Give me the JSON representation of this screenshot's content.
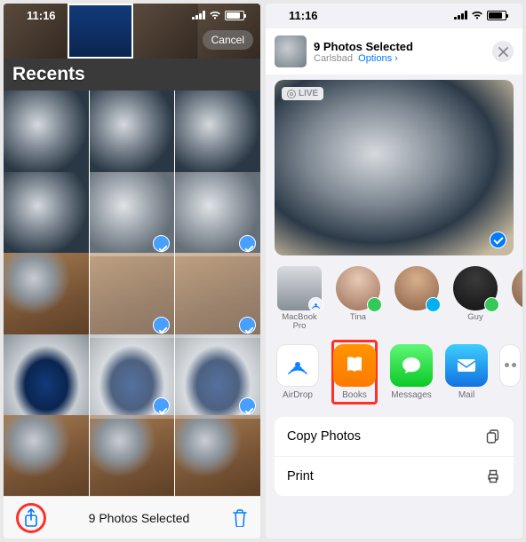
{
  "left": {
    "time": "11:16",
    "cancel": "Cancel",
    "album": "Recents",
    "selected_count": "9 Photos Selected"
  },
  "right": {
    "time": "11:16",
    "header_title": "9 Photos Selected",
    "header_location": "Carlsbad",
    "header_options": "Options",
    "live_badge": "LIVE",
    "contacts": [
      {
        "name": "MacBook\nPro"
      },
      {
        "name": "Tina"
      },
      {
        "name": ""
      },
      {
        "name": "Guy"
      },
      {
        "name": ""
      }
    ],
    "apps": [
      {
        "name": "AirDrop"
      },
      {
        "name": "Books"
      },
      {
        "name": "Messages"
      },
      {
        "name": "Mail"
      }
    ],
    "actions": {
      "copy": "Copy Photos",
      "print": "Print"
    }
  }
}
